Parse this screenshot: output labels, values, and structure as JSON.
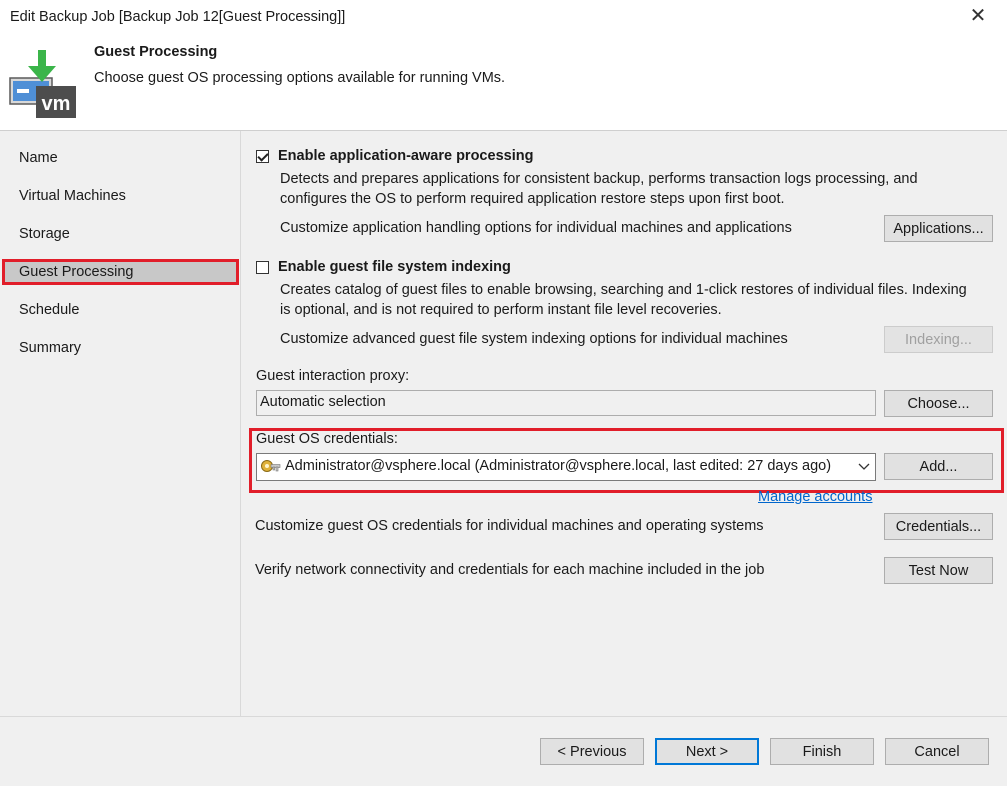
{
  "window": {
    "title": "Edit Backup Job [Backup Job 12[Guest Processing]]",
    "close_glyph": "✕"
  },
  "header": {
    "title": "Guest Processing",
    "subtitle": "Choose guest OS processing options available for running VMs.",
    "logo_text": "vm"
  },
  "sidebar": {
    "items": [
      {
        "label": "Name"
      },
      {
        "label": "Virtual Machines"
      },
      {
        "label": "Storage"
      },
      {
        "label": "Guest Processing",
        "selected": true
      },
      {
        "label": "Schedule"
      },
      {
        "label": "Summary"
      }
    ]
  },
  "app_aware": {
    "checked": true,
    "label": "Enable application-aware processing",
    "desc_line1": "Detects and prepares applications for consistent backup, performs transaction logs processing, and",
    "desc_line2": "configures the OS to perform required application restore steps upon first boot.",
    "customize_text": "Customize application handling options for individual machines and applications",
    "button_label": "Applications..."
  },
  "indexing": {
    "checked": false,
    "label": "Enable guest file system indexing",
    "desc_line1": "Creates catalog of guest files to enable browsing, searching and 1-click restores of individual files. Indexing",
    "desc_line2": "is optional, and is not required to perform instant file level recoveries.",
    "customize_text": "Customize advanced guest file system indexing options for individual machines",
    "button_label": "Indexing...",
    "button_enabled": false
  },
  "proxy": {
    "label": "Guest interaction proxy:",
    "value": "Automatic selection",
    "button_label": "Choose..."
  },
  "credentials": {
    "label": "Guest OS credentials:",
    "selected_value": "Administrator@vsphere.local (Administrator@vsphere.local, last edited: 27 days ago)",
    "add_button_label": "Add...",
    "manage_link": "Manage accounts",
    "customize_text": "Customize guest OS credentials for individual machines and operating systems",
    "customize_button_label": "Credentials...",
    "verify_text": "Verify network connectivity and credentials for each machine included in the job",
    "test_button_label": "Test Now"
  },
  "footer": {
    "previous": "< Previous",
    "next": "Next >",
    "finish": "Finish",
    "cancel": "Cancel"
  },
  "colors": {
    "highlight_red": "#e11e2a",
    "link_blue": "#0066cc",
    "focus_blue": "#0078d7",
    "logo_green": "#3bb54a",
    "logo_dark": "#4d4d4d"
  }
}
